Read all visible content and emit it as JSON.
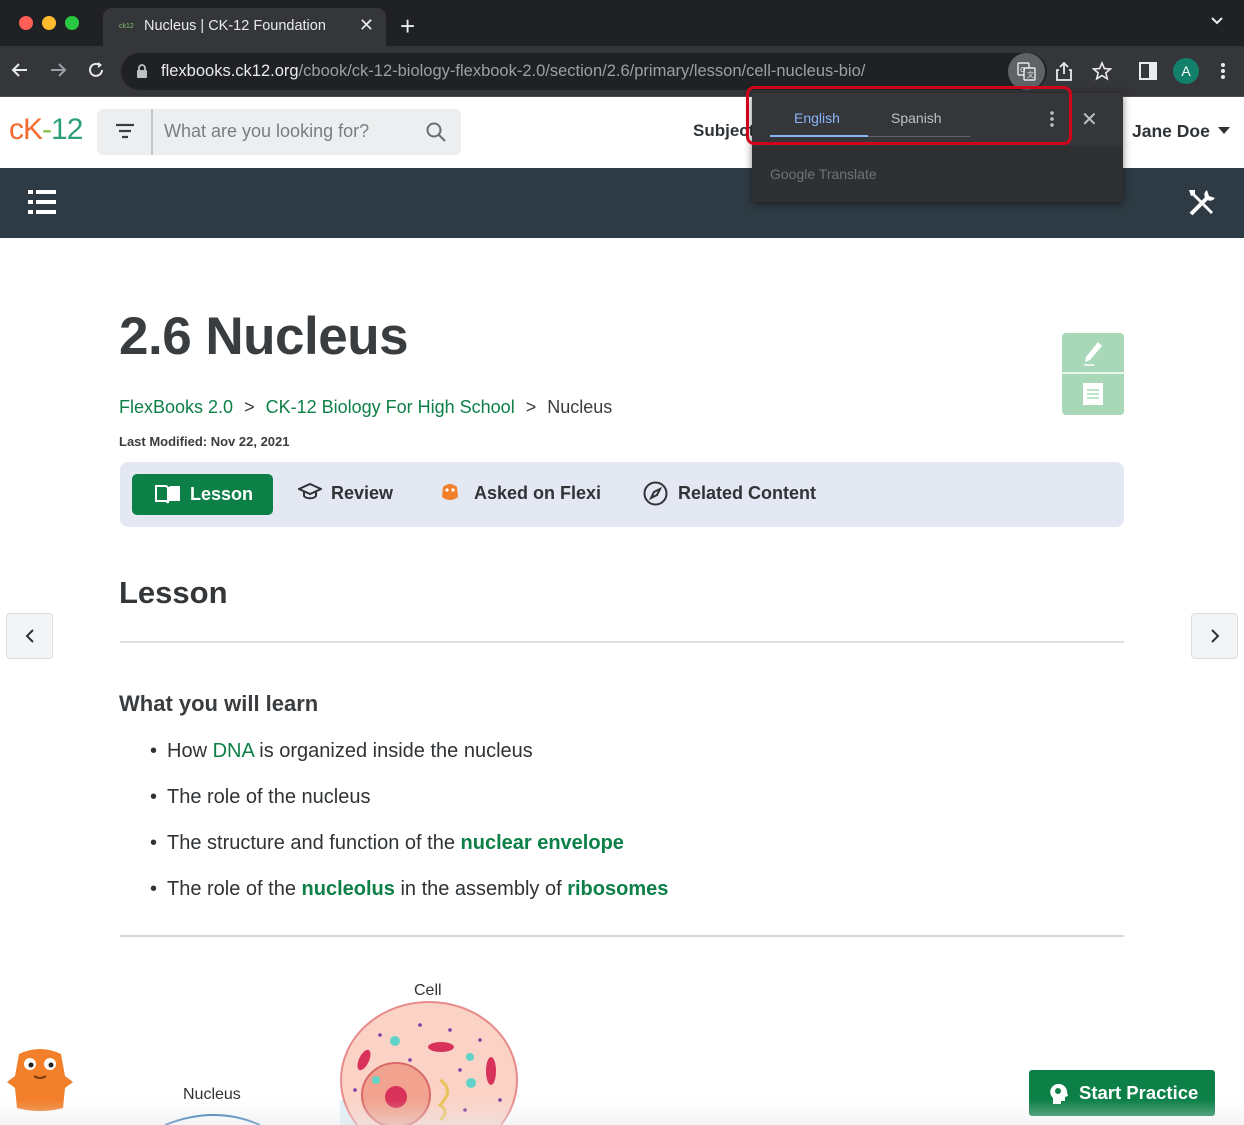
{
  "browser": {
    "tab_title": "Nucleus | CK-12 Foundation",
    "tab_favicon_text": "ck12",
    "url_host": "flexbooks.ck12.org",
    "url_path": "/cbook/ck-12-biology-flexbook-2.0/section/2.6/primary/lesson/cell-nucleus-bio/",
    "profile_initial": "A",
    "icons": [
      "back-icon",
      "forward-icon",
      "reload-icon",
      "lock-icon",
      "translate-icon",
      "share-icon",
      "star-icon",
      "side-panel-icon",
      "menu-icon"
    ]
  },
  "translate_popup": {
    "languages": [
      "English",
      "Spanish"
    ],
    "selected": "English",
    "powered_by": "Google Translate",
    "highlight_color": "#d0021b"
  },
  "header": {
    "logo": {
      "c": "c",
      "k": "K",
      "dash": "-",
      "n": "12"
    },
    "search_placeholder": "What are you looking for?",
    "subjects_label": "Subjects",
    "user_name": "Jane Doe"
  },
  "page": {
    "title": "2.6 Nucleus",
    "breadcrumb": [
      "FlexBooks 2.0",
      "CK-12 Biology For High School",
      "Nucleus"
    ],
    "breadcrumb_sep": ">",
    "last_modified": "Last Modified: Nov 22, 2021",
    "tabs": {
      "lesson": "Lesson",
      "review": "Review",
      "asked": "Asked on Flexi",
      "related": "Related Content"
    },
    "section_heading": "Lesson",
    "learn_heading": "What you will learn",
    "bullets": {
      "b1": {
        "pre": "How ",
        "term": "DNA",
        "post": " is organized inside the nucleus"
      },
      "b2": {
        "text": "The role of the nucleus"
      },
      "b3": {
        "pre": "The structure and function of the ",
        "term": "nuclear envelope"
      },
      "b4": {
        "pre": "The role of the ",
        "term1": "nucleolus",
        "mid": " in the assembly of ",
        "term2": "ribosomes"
      }
    },
    "figure": {
      "cell_label": "Cell",
      "nucleus_label": "Nucleus"
    },
    "start_practice": "Start Practice"
  },
  "colors": {
    "brand_green": "#0d8048",
    "nav_dark": "#2e3b44",
    "tabs_bg": "#e3e8f3",
    "logo_orange": "#f26b2f"
  }
}
